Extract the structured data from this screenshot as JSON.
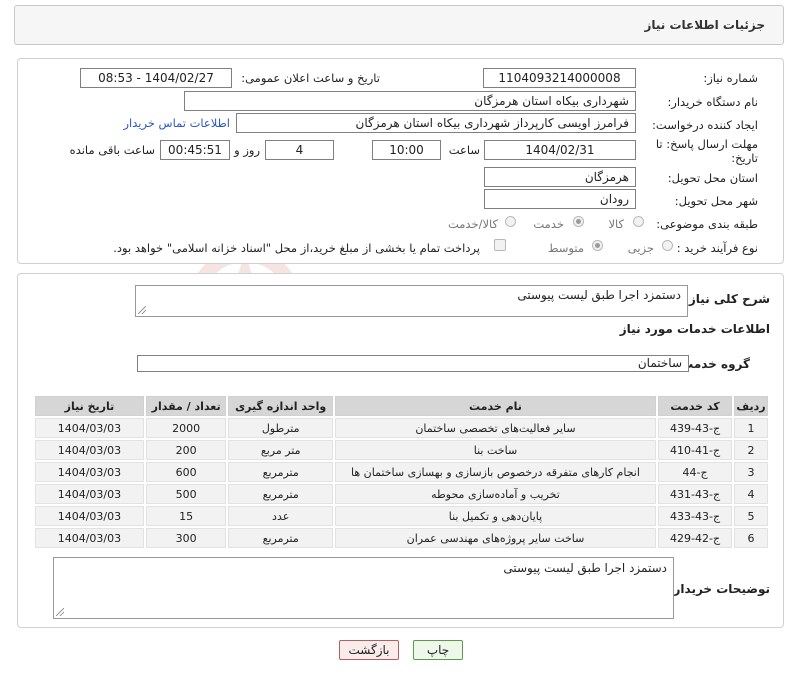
{
  "header": {
    "title": "جزئیات اطلاعات نیاز"
  },
  "form": {
    "need_number": {
      "label": "شماره نیاز:",
      "value": "1104093214000008"
    },
    "announce_datetime": {
      "label": "تاریخ و ساعت اعلان عمومی:",
      "value": "1404/02/27 - 08:53"
    },
    "buyer_org": {
      "label": "نام دستگاه خریدار:",
      "value": "شهرداری بیکاه استان هرمزگان"
    },
    "requester": {
      "label": "ایجاد کننده درخواست:",
      "value": "فرامرز اویسی کارپرداز شهرداری بیکاه استان هرمزگان",
      "contact_link": "اطلاعات تماس خریدار"
    },
    "deadline": {
      "label_line1": "مهلت ارسال پاسخ: تا",
      "label_line2": "تاریخ:",
      "date": "1404/02/31",
      "time_label": "ساعت",
      "time": "10:00",
      "days": "4",
      "days_label": "روز و",
      "remaining": "00:45:51",
      "remaining_label": "ساعت باقی مانده"
    },
    "province": {
      "label": "استان محل تحویل:",
      "value": "هرمزگان"
    },
    "city": {
      "label": "شهر محل تحویل:",
      "value": "رودان"
    },
    "category": {
      "label": "طبقه بندی موضوعی:",
      "options": [
        "کالا",
        "خدمت",
        "کالا/خدمت"
      ],
      "selected": "خدمت"
    },
    "process_type": {
      "label": "نوع فرآیند خرید :",
      "options": [
        "جزیی",
        "متوسط"
      ],
      "selected": "متوسط",
      "payment_note": "پرداخت تمام یا بخشی از مبلغ خرید،از محل \"اسناد خزانه اسلامی\" خواهد بود."
    }
  },
  "summary": {
    "label": "شرح کلی نیاز:",
    "value": "دستمزد اجرا طبق لیست پیوستی",
    "services_heading": "اطلاعات خدمات مورد نیاز",
    "service_group_label": "گروه خدمت:",
    "service_group_value": "ساختمان"
  },
  "table": {
    "headers": [
      "ردیف",
      "کد خدمت",
      "نام خدمت",
      "واحد اندازه گیری",
      "تعداد / مقدار",
      "تاریخ نیاز"
    ],
    "rows": [
      [
        "1",
        "ج-43-439",
        "سایر فعالیت‌های تخصصی ساختمان",
        "مترطول",
        "2000",
        "1404/03/03"
      ],
      [
        "2",
        "ج-41-410",
        "ساخت بنا",
        "متر مربع",
        "200",
        "1404/03/03"
      ],
      [
        "3",
        "ج-44",
        "انجام کارهای متفرقه درخصوص بازسازی و بهسازی ساختمان ها",
        "مترمربع",
        "600",
        "1404/03/03"
      ],
      [
        "4",
        "ج-43-431",
        "تخریب و آماده‌سازی محوطه",
        "مترمربع",
        "500",
        "1404/03/03"
      ],
      [
        "5",
        "ج-43-433",
        "پایان‌دهی و تکمیل بنا",
        "عدد",
        "15",
        "1404/03/03"
      ],
      [
        "6",
        "ج-42-429",
        "ساخت سایر پروژه‌های مهندسی عمران",
        "مترمربع",
        "300",
        "1404/03/03"
      ]
    ]
  },
  "buyer_notes": {
    "label": "توضیحات خریدار:",
    "value": "دستمزد اجرا طبق لیست پیوستی"
  },
  "buttons": {
    "print": "چاپ",
    "back": "بازگشت"
  },
  "watermark": {
    "text": "AriaTender.neT",
    "color": "#c0392b"
  }
}
